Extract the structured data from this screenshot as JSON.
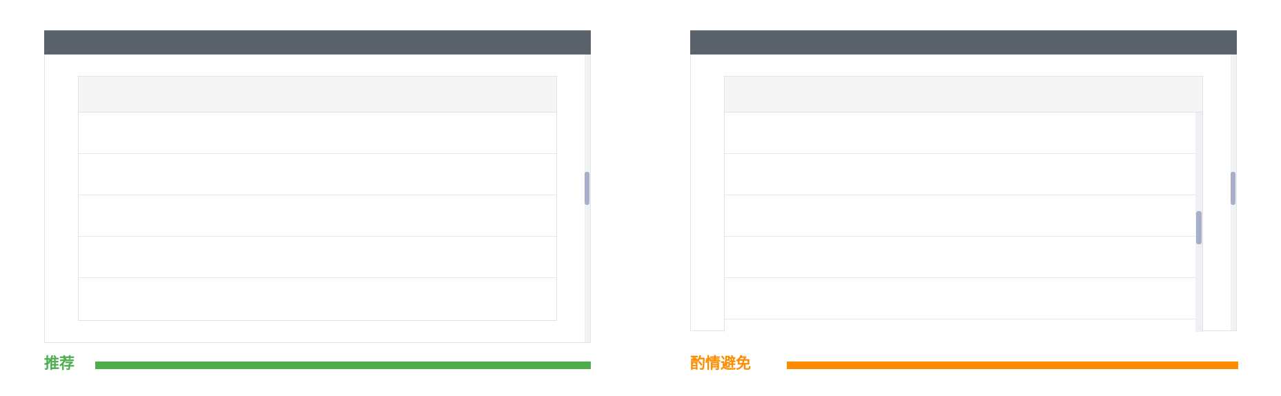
{
  "guidelines": {
    "recommended": {
      "label": "推荐",
      "color": "#4cae4c"
    },
    "avoid": {
      "label": "酌情避免",
      "color": "#ff8c00"
    }
  },
  "colors": {
    "header": "#5a636c",
    "table_header": "#f5f5f5",
    "scrollbar_thumb": "#a8afc9"
  },
  "examples": {
    "left": {
      "table_rows": 5,
      "scrollbars": [
        "dialog"
      ]
    },
    "right": {
      "table_rows": 6,
      "scrollbars": [
        "dialog",
        "table"
      ]
    }
  }
}
